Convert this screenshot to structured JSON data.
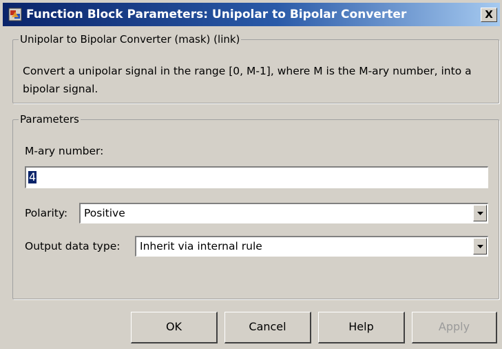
{
  "window": {
    "title": "Function Block Parameters: Unipolar to Bipolar Converter",
    "close_label": "X"
  },
  "description_group": {
    "legend": "Unipolar to Bipolar Converter (mask) (link)",
    "text": "Convert a unipolar signal in the range [0, M-1], where M is the M-ary number,  into a bipolar signal."
  },
  "parameters_group": {
    "legend": "Parameters",
    "mary": {
      "label": "M-ary number:",
      "value": "4"
    },
    "polarity": {
      "label": "Polarity:",
      "value": "Positive"
    },
    "output_type": {
      "label": "Output data type:",
      "value": "Inherit via internal rule"
    }
  },
  "buttons": {
    "ok": "OK",
    "cancel": "Cancel",
    "help": "Help",
    "apply": "Apply"
  },
  "colors": {
    "title_bar": "#0a246a",
    "dialog_bg": "#d4d0c8",
    "selection": "#0a246a"
  }
}
